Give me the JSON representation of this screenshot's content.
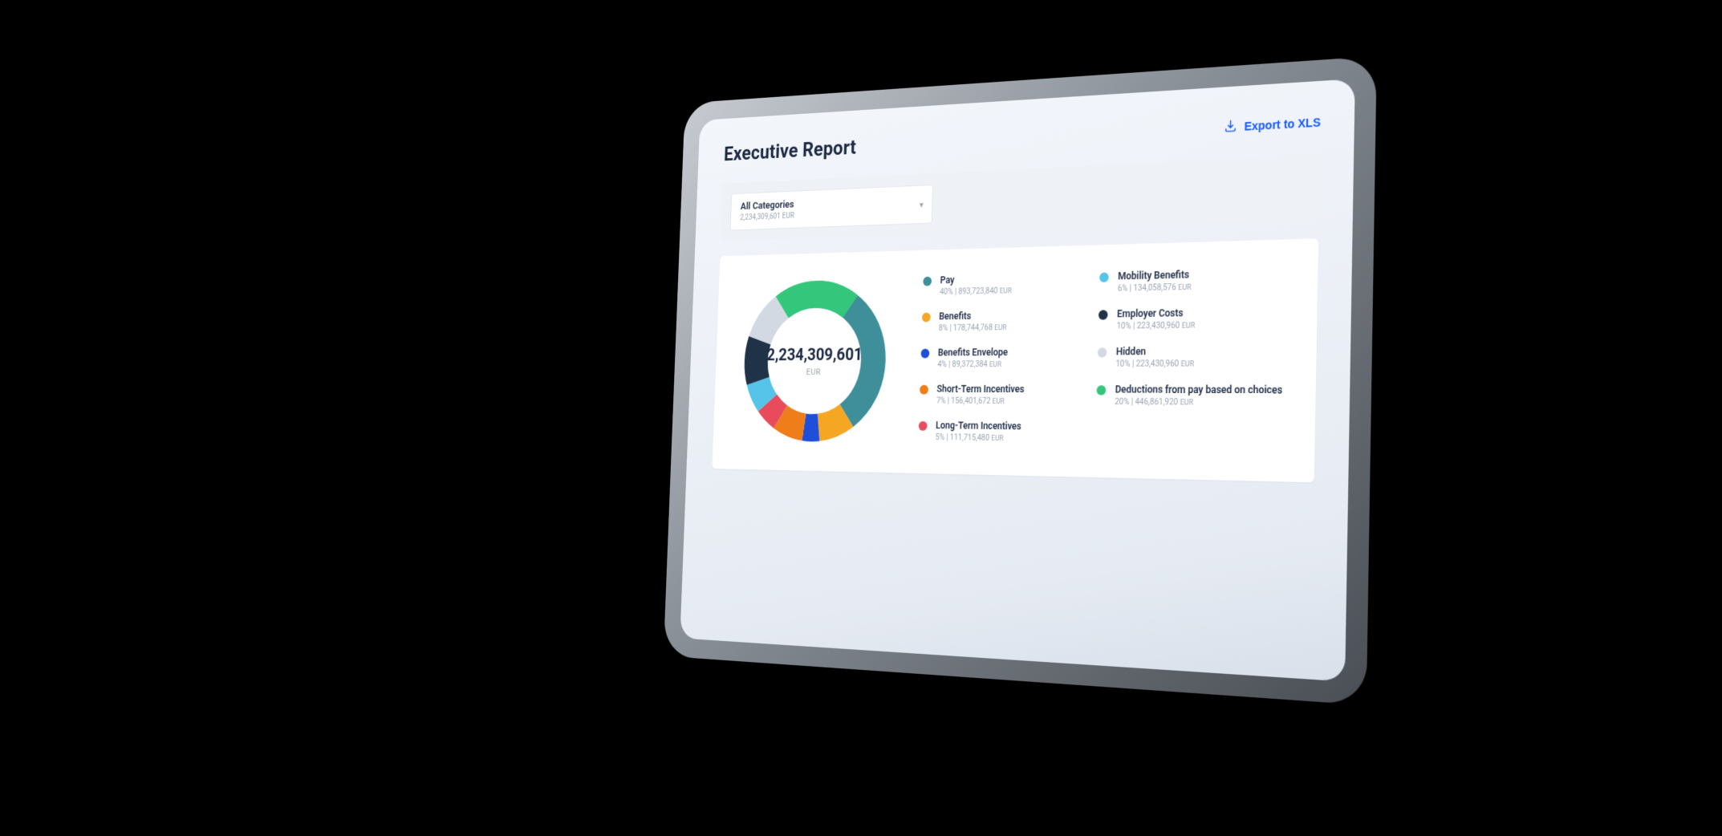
{
  "header": {
    "title": "Executive Report",
    "export_label": "Export to XLS"
  },
  "filter": {
    "selected_label": "All Categories",
    "selected_sub": "2,234,309,601 EUR"
  },
  "chart_data": {
    "type": "pie",
    "title": "",
    "center_total": "2,234,309,601",
    "center_currency": "EUR",
    "series": [
      {
        "name": "Pay",
        "pct": 40,
        "value": "893,723,840",
        "unit": "EUR",
        "color": "#3e8f9a"
      },
      {
        "name": "Benefits",
        "pct": 8,
        "value": "178,744,768",
        "unit": "EUR",
        "color": "#f5a623"
      },
      {
        "name": "Benefits Envelope",
        "pct": 4,
        "value": "89,372,384",
        "unit": "EUR",
        "color": "#1f4fd9"
      },
      {
        "name": "Short-Term Incentives",
        "pct": 7,
        "value": "156,401,672",
        "unit": "EUR",
        "color": "#ef7d1a"
      },
      {
        "name": "Long-Term Incentives",
        "pct": 5,
        "value": "111,715,480",
        "unit": "EUR",
        "color": "#e84b5b"
      },
      {
        "name": "Mobility Benefits",
        "pct": 6,
        "value": "134,058,576",
        "unit": "EUR",
        "color": "#55c4e8"
      },
      {
        "name": "Employer Costs",
        "pct": 10,
        "value": "223,430,960",
        "unit": "EUR",
        "color": "#1f3247"
      },
      {
        "name": "Hidden",
        "pct": 10,
        "value": "223,430,960",
        "unit": "EUR",
        "color": "#d3d9e3"
      },
      {
        "name": "Deductions from pay based on choices",
        "pct": 20,
        "value": "446,861,920",
        "unit": "EUR",
        "color": "#34c77b"
      }
    ]
  }
}
